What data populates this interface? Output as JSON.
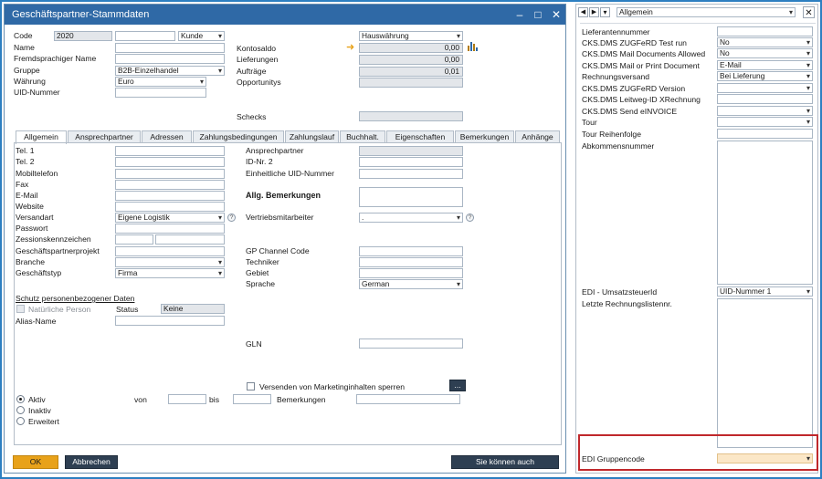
{
  "window": {
    "title": "Geschäftspartner-Stammdaten",
    "minimize": "–",
    "maximize": "□",
    "close": "✕"
  },
  "header": {
    "code_label": "Code",
    "code_value": "2020",
    "type_value": "Kunde",
    "name_label": "Name",
    "foreign_name_label": "Fremdsprachiger Name",
    "group_label": "Gruppe",
    "group_value": "B2B-Einzelhandel",
    "currency_label": "Währung",
    "currency_value": "Euro",
    "vat_label": "UID-Nummer",
    "local_currency_value": "Hauswährung",
    "balance_label": "Kontosaldo",
    "balance_value": "0,00",
    "deliveries_label": "Lieferungen",
    "deliveries_value": "0,00",
    "orders_label": "Aufträge",
    "orders_value": "0,01",
    "opportunities_label": "Opportunitys",
    "checks_label": "Schecks"
  },
  "tabs": [
    "Allgemein",
    "Ansprechpartner",
    "Adressen",
    "Zahlungsbedingungen",
    "Zahlungslauf",
    "Buchhalt.",
    "Eigenschaften",
    "Bemerkungen",
    "Anhänge"
  ],
  "general": {
    "left": [
      {
        "label": "Tel. 1",
        "value": ""
      },
      {
        "label": "Tel. 2",
        "value": ""
      },
      {
        "label": "Mobiltelefon",
        "value": ""
      },
      {
        "label": "Fax",
        "value": ""
      },
      {
        "label": "E-Mail",
        "value": ""
      },
      {
        "label": "Website",
        "value": ""
      },
      {
        "label": "Versandart",
        "value": "Eigene Logistik"
      },
      {
        "label": "Passwort",
        "value": ""
      },
      {
        "label": "Zessionskennzeichen",
        "value": ""
      },
      {
        "label": "Geschäftspartnerprojekt",
        "value": ""
      },
      {
        "label": "Branche",
        "value": ""
      },
      {
        "label": "Geschäftstyp",
        "value": "Firma"
      }
    ],
    "right": {
      "contact_label": "Ansprechpartner",
      "id2_label": "ID-Nr. 2",
      "uid_label": "Einheitliche UID-Nummer",
      "remarks_label": "Allg. Bemerkungen",
      "sales_label": "Vertriebsmitarbeiter",
      "sales_value": ".",
      "gp_channel_label": "GP Channel Code",
      "technician_label": "Techniker",
      "territory_label": "Gebiet",
      "language_label": "Sprache",
      "language_value": "German",
      "gln_label": "GLN"
    },
    "privacy_heading": "Schutz personenbezogener Daten",
    "natural_person_label": "Natürliche Person",
    "status_label": "Status",
    "status_value": "Keine",
    "alias_label": "Alias-Name",
    "marketing_label": "Versenden von Marketinginhalten sperren",
    "more_label": "...",
    "active_label": "Aktiv",
    "inactive_label": "Inaktiv",
    "advanced_label": "Erweitert",
    "from_label": "von",
    "to_label": "bis",
    "remarks2_label": "Bemerkungen"
  },
  "footer": {
    "ok": "OK",
    "cancel": "Abbrechen",
    "you_can_also": "Sie können auch"
  },
  "side_panel": {
    "nav_prev": "◀",
    "nav_next": "▶",
    "nav_menu": "▾",
    "category_value": "Allgemein",
    "close": "✕",
    "rows": [
      {
        "label": "Lieferantennummer",
        "value": ""
      },
      {
        "label": "CKS.DMS ZUGFeRD Test run",
        "value": "No"
      },
      {
        "label": "CKS.DMS Mail Documents Allowed",
        "value": "No"
      },
      {
        "label": "CKS.DMS Mail or Print Document",
        "value": "E-Mail"
      },
      {
        "label": "Rechnungsversand",
        "value": "Bei Lieferung"
      },
      {
        "label": "CKS.DMS ZUGFeRD Version",
        "value": ""
      },
      {
        "label": "CKS.DMS Leitweg-ID XRechnung",
        "value": ""
      },
      {
        "label": "CKS.DMS Send eINVOICE",
        "value": ""
      },
      {
        "label": "Tour",
        "value": ""
      },
      {
        "label": "Tour Reihenfolge",
        "value": ""
      }
    ],
    "agreement_label": "Abkommensnummer",
    "edi_vat_label": "EDI - UmsatzsteuerId",
    "edi_vat_value": "UID-Nummer 1",
    "last_invoice_label": "Letzte Rechnungslistennr.",
    "edi_group_label": "EDI Gruppencode",
    "edi_group_value": ""
  }
}
